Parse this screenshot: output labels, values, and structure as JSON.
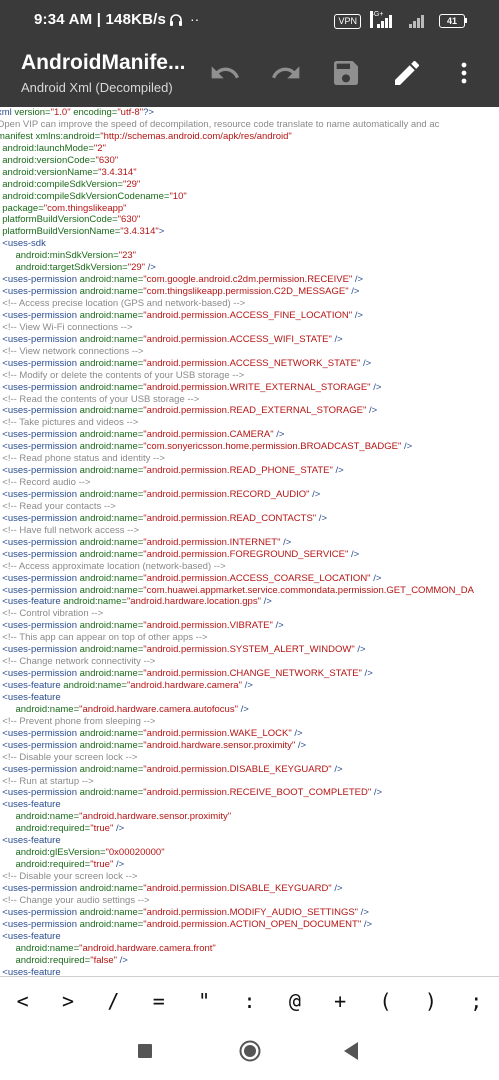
{
  "status_bar": {
    "time": "9:34 AM | 148KB/s",
    "vpn": "VPN",
    "network": "4G+",
    "battery": "41"
  },
  "app_bar": {
    "title": "AndroidManife...",
    "subtitle": "Android Xml (Decompiled)",
    "actions": [
      "undo-icon",
      "redo-icon",
      "save-icon",
      "edit-icon",
      "more-icon"
    ]
  },
  "code_lines": [
    [
      [
        "t",
        "xml "
      ],
      [
        "a",
        "version="
      ],
      [
        "s",
        "\"1.0\""
      ],
      [
        "a",
        " encoding="
      ],
      [
        "s",
        "\"utf-8\""
      ],
      [
        "t",
        "?>"
      ]
    ],
    [
      [
        "c",
        "Open VIP can improve the speed of decompilation, resource code translate to name automatically and ac"
      ]
    ],
    [
      [
        "a",
        "manifest xmlns:android="
      ],
      [
        "s",
        "\"http://schemas.android.com/apk/res/android\""
      ]
    ],
    [
      [
        "a",
        "  android:launchMode="
      ],
      [
        "s",
        "\"2\""
      ]
    ],
    [
      [
        "a",
        "  android:versionCode="
      ],
      [
        "s",
        "\"630\""
      ]
    ],
    [
      [
        "a",
        "  android:versionName="
      ],
      [
        "s",
        "\"3.4.314\""
      ]
    ],
    [
      [
        "a",
        "  android:compileSdkVersion="
      ],
      [
        "s",
        "\"29\""
      ]
    ],
    [
      [
        "a",
        "  android:compileSdkVersionCodename="
      ],
      [
        "s",
        "\"10\""
      ]
    ],
    [
      [
        "a",
        "  package="
      ],
      [
        "s",
        "\"com.thingslikeapp\""
      ]
    ],
    [
      [
        "a",
        "  platformBuildVersionCode="
      ],
      [
        "s",
        "\"630\""
      ]
    ],
    [
      [
        "a",
        "  platformBuildVersionName="
      ],
      [
        "s",
        "\"3.4.314\""
      ],
      [
        "t",
        ">"
      ]
    ],
    [
      [
        "t",
        "  <uses-sdk"
      ]
    ],
    [
      [
        "a",
        "       android:minSdkVersion="
      ],
      [
        "s",
        "\"23\""
      ]
    ],
    [
      [
        "a",
        "       android:targetSdkVersion="
      ],
      [
        "s",
        "\"29\""
      ],
      [
        "t",
        " />"
      ]
    ],
    [
      [
        "t",
        "  <uses-permission"
      ],
      [
        "a",
        " android:name="
      ],
      [
        "s",
        "\"com.google.android.c2dm.permission.RECEIVE\""
      ],
      [
        "t",
        " />"
      ]
    ],
    [
      [
        "t",
        "  <uses-permission"
      ],
      [
        "a",
        " android:name="
      ],
      [
        "s",
        "\"com.thingslikeapp.permission.C2D_MESSAGE\""
      ],
      [
        "t",
        " />"
      ]
    ],
    [
      [
        "c",
        "  <!-- Access precise location (GPS and network-based) -->"
      ]
    ],
    [
      [
        "t",
        "  <uses-permission"
      ],
      [
        "a",
        " android:name="
      ],
      [
        "s",
        "\"android.permission.ACCESS_FINE_LOCATION\""
      ],
      [
        "t",
        " />"
      ]
    ],
    [
      [
        "c",
        "  <!-- View Wi-Fi connections -->"
      ]
    ],
    [
      [
        "t",
        "  <uses-permission"
      ],
      [
        "a",
        " android:name="
      ],
      [
        "s",
        "\"android.permission.ACCESS_WIFI_STATE\""
      ],
      [
        "t",
        " />"
      ]
    ],
    [
      [
        "c",
        "  <!-- View network connections -->"
      ]
    ],
    [
      [
        "t",
        "  <uses-permission"
      ],
      [
        "a",
        " android:name="
      ],
      [
        "s",
        "\"android.permission.ACCESS_NETWORK_STATE\""
      ],
      [
        "t",
        " />"
      ]
    ],
    [
      [
        "c",
        "  <!-- Modify or delete the contents of your USB storage -->"
      ]
    ],
    [
      [
        "t",
        "  <uses-permission"
      ],
      [
        "a",
        " android:name="
      ],
      [
        "s",
        "\"android.permission.WRITE_EXTERNAL_STORAGE\""
      ],
      [
        "t",
        " />"
      ]
    ],
    [
      [
        "c",
        "  <!-- Read the contents of your USB storage -->"
      ]
    ],
    [
      [
        "t",
        "  <uses-permission"
      ],
      [
        "a",
        " android:name="
      ],
      [
        "s",
        "\"android.permission.READ_EXTERNAL_STORAGE\""
      ],
      [
        "t",
        " />"
      ]
    ],
    [
      [
        "c",
        "  <!-- Take pictures and videos -->"
      ]
    ],
    [
      [
        "t",
        "  <uses-permission"
      ],
      [
        "a",
        " android:name="
      ],
      [
        "s",
        "\"android.permission.CAMERA\""
      ],
      [
        "t",
        " />"
      ]
    ],
    [
      [
        "t",
        "  <uses-permission"
      ],
      [
        "a",
        " android:name="
      ],
      [
        "s",
        "\"com.sonyericsson.home.permission.BROADCAST_BADGE\""
      ],
      [
        "t",
        " />"
      ]
    ],
    [
      [
        "c",
        "  <!-- Read phone status and identity -->"
      ]
    ],
    [
      [
        "t",
        "  <uses-permission"
      ],
      [
        "a",
        " android:name="
      ],
      [
        "s",
        "\"android.permission.READ_PHONE_STATE\""
      ],
      [
        "t",
        " />"
      ]
    ],
    [
      [
        "c",
        "  <!-- Record audio -->"
      ]
    ],
    [
      [
        "t",
        "  <uses-permission"
      ],
      [
        "a",
        " android:name="
      ],
      [
        "s",
        "\"android.permission.RECORD_AUDIO\""
      ],
      [
        "t",
        " />"
      ]
    ],
    [
      [
        "c",
        "  <!-- Read your contacts -->"
      ]
    ],
    [
      [
        "t",
        "  <uses-permission"
      ],
      [
        "a",
        " android:name="
      ],
      [
        "s",
        "\"android.permission.READ_CONTACTS\""
      ],
      [
        "t",
        " />"
      ]
    ],
    [
      [
        "c",
        "  <!-- Have full network access -->"
      ]
    ],
    [
      [
        "t",
        "  <uses-permission"
      ],
      [
        "a",
        " android:name="
      ],
      [
        "s",
        "\"android.permission.INTERNET\""
      ],
      [
        "t",
        " />"
      ]
    ],
    [
      [
        "t",
        "  <uses-permission"
      ],
      [
        "a",
        " android:name="
      ],
      [
        "s",
        "\"android.permission.FOREGROUND_SERVICE\""
      ],
      [
        "t",
        " />"
      ]
    ],
    [
      [
        "c",
        "  <!-- Access approximate location (network-based) -->"
      ]
    ],
    [
      [
        "t",
        "  <uses-permission"
      ],
      [
        "a",
        " android:name="
      ],
      [
        "s",
        "\"android.permission.ACCESS_COARSE_LOCATION\""
      ],
      [
        "t",
        " />"
      ]
    ],
    [
      [
        "t",
        "  <uses-permission"
      ],
      [
        "a",
        " android:name="
      ],
      [
        "s",
        "\"com.huawei.appmarket.service.commondata.permission.GET_COMMON_DA"
      ]
    ],
    [
      [
        "t",
        "  <uses-feature"
      ],
      [
        "a",
        " android:name="
      ],
      [
        "s",
        "\"android.hardware.location.gps\""
      ],
      [
        "t",
        " />"
      ]
    ],
    [
      [
        "c",
        "  <!-- Control vibration -->"
      ]
    ],
    [
      [
        "t",
        "  <uses-permission"
      ],
      [
        "a",
        " android:name="
      ],
      [
        "s",
        "\"android.permission.VIBRATE\""
      ],
      [
        "t",
        " />"
      ]
    ],
    [
      [
        "c",
        "  <!-- This app can appear on top of other apps -->"
      ]
    ],
    [
      [
        "t",
        "  <uses-permission"
      ],
      [
        "a",
        " android:name="
      ],
      [
        "s",
        "\"android.permission.SYSTEM_ALERT_WINDOW\""
      ],
      [
        "t",
        " />"
      ]
    ],
    [
      [
        "c",
        "  <!-- Change network connectivity -->"
      ]
    ],
    [
      [
        "t",
        "  <uses-permission"
      ],
      [
        "a",
        " android:name="
      ],
      [
        "s",
        "\"android.permission.CHANGE_NETWORK_STATE\""
      ],
      [
        "t",
        " />"
      ]
    ],
    [
      [
        "t",
        "  <uses-feature"
      ],
      [
        "a",
        " android:name="
      ],
      [
        "s",
        "\"android.hardware.camera\""
      ],
      [
        "t",
        " />"
      ]
    ],
    [
      [
        "t",
        "  <uses-feature"
      ]
    ],
    [
      [
        "a",
        "       android:name="
      ],
      [
        "s",
        "\"android.hardware.camera.autofocus\""
      ],
      [
        "t",
        " />"
      ]
    ],
    [
      [
        "c",
        "  <!-- Prevent phone from sleeping -->"
      ]
    ],
    [
      [
        "t",
        "  <uses-permission"
      ],
      [
        "a",
        " android:name="
      ],
      [
        "s",
        "\"android.permission.WAKE_LOCK\""
      ],
      [
        "t",
        " />"
      ]
    ],
    [
      [
        "t",
        "  <uses-permission"
      ],
      [
        "a",
        " android:name="
      ],
      [
        "s",
        "\"android.hardware.sensor.proximity\""
      ],
      [
        "t",
        " />"
      ]
    ],
    [
      [
        "c",
        "  <!-- Disable your screen lock -->"
      ]
    ],
    [
      [
        "t",
        "  <uses-permission"
      ],
      [
        "a",
        " android:name="
      ],
      [
        "s",
        "\"android.permission.DISABLE_KEYGUARD\""
      ],
      [
        "t",
        " />"
      ]
    ],
    [
      [
        "c",
        "  <!-- Run at startup -->"
      ]
    ],
    [
      [
        "t",
        "  <uses-permission"
      ],
      [
        "a",
        " android:name="
      ],
      [
        "s",
        "\"android.permission.RECEIVE_BOOT_COMPLETED\""
      ],
      [
        "t",
        " />"
      ]
    ],
    [
      [
        "t",
        "  <uses-feature"
      ]
    ],
    [
      [
        "a",
        "       android:name="
      ],
      [
        "s",
        "\"android.hardware.sensor.proximity\""
      ]
    ],
    [
      [
        "a",
        "       android:required="
      ],
      [
        "s",
        "\"true\""
      ],
      [
        "t",
        " />"
      ]
    ],
    [
      [
        "t",
        "  <uses-feature"
      ]
    ],
    [
      [
        "a",
        "       android:glEsVersion="
      ],
      [
        "s",
        "\"0x00020000\""
      ]
    ],
    [
      [
        "a",
        "       android:required="
      ],
      [
        "s",
        "\"true\""
      ],
      [
        "t",
        " />"
      ]
    ],
    [
      [
        "c",
        "  <!-- Disable your screen lock -->"
      ]
    ],
    [
      [
        "t",
        "  <uses-permission"
      ],
      [
        "a",
        " android:name="
      ],
      [
        "s",
        "\"android.permission.DISABLE_KEYGUARD\""
      ],
      [
        "t",
        " />"
      ]
    ],
    [
      [
        "c",
        "  <!-- Change your audio settings -->"
      ]
    ],
    [
      [
        "t",
        "  <uses-permission"
      ],
      [
        "a",
        " android:name="
      ],
      [
        "s",
        "\"android.permission.MODIFY_AUDIO_SETTINGS\""
      ],
      [
        "t",
        " />"
      ]
    ],
    [
      [
        "t",
        "  <uses-permission"
      ],
      [
        "a",
        " android:name="
      ],
      [
        "s",
        "\"android.permission.ACTION_OPEN_DOCUMENT\""
      ],
      [
        "t",
        " />"
      ]
    ],
    [
      [
        "t",
        "  <uses-feature"
      ]
    ],
    [
      [
        "a",
        "       android:name="
      ],
      [
        "s",
        "\"android.hardware.camera.front\""
      ]
    ],
    [
      [
        "a",
        "       android:required="
      ],
      [
        "s",
        "\"false\""
      ],
      [
        "t",
        " />"
      ]
    ],
    [
      [
        "t",
        "  <uses-feature"
      ]
    ]
  ],
  "symbol_bar": [
    "<",
    ">",
    "/",
    "=",
    "\"",
    ":",
    "@",
    "+",
    "(",
    ")",
    ";"
  ],
  "nav_bar": [
    "recents-button",
    "home-button",
    "back-button"
  ]
}
